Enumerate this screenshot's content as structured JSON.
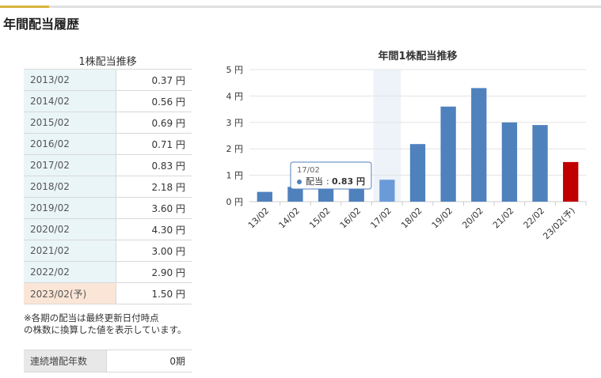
{
  "page": {
    "section_title": "年間配当履歴"
  },
  "table": {
    "title": "1株配当推移",
    "rows": [
      {
        "year": "2013/02",
        "value": "0.37 円"
      },
      {
        "year": "2014/02",
        "value": "0.56 円"
      },
      {
        "year": "2015/02",
        "value": "0.69 円"
      },
      {
        "year": "2016/02",
        "value": "0.71 円"
      },
      {
        "year": "2017/02",
        "value": "0.83 円"
      },
      {
        "year": "2018/02",
        "value": "2.18 円"
      },
      {
        "year": "2019/02",
        "value": "3.60 円"
      },
      {
        "year": "2020/02",
        "value": "4.30 円"
      },
      {
        "year": "2021/02",
        "value": "3.00 円"
      },
      {
        "year": "2022/02",
        "value": "2.90 円"
      },
      {
        "year": "2023/02(予)",
        "value": "1.50 円"
      }
    ]
  },
  "note": {
    "line1": "※各期の配当は最終更新日付時点",
    "line2": "の株数に換算した値を表示しています。"
  },
  "streak": {
    "label": "連続増配年数",
    "value": "0期"
  },
  "tooltip": {
    "category": "17/02",
    "series_label": "配当",
    "value": "0.83 円",
    "highlight_index": 4
  },
  "colors": {
    "bar": "#4f81bd",
    "bar_hover": "#6a9bd8",
    "forecast": "#c00000",
    "table_year_bg": "#eaf5f8",
    "forecast_bg": "#fbe5d6"
  },
  "chart_data": {
    "type": "bar",
    "title": "年間1株配当推移",
    "categories": [
      "13/02",
      "14/02",
      "15/02",
      "16/02",
      "17/02",
      "18/02",
      "19/02",
      "20/02",
      "21/02",
      "22/02",
      "23/02(予)"
    ],
    "values": [
      0.37,
      0.56,
      0.69,
      0.71,
      0.83,
      2.18,
      3.6,
      4.3,
      3.0,
      2.9,
      1.5
    ],
    "forecast_index": 10,
    "ylim": [
      0,
      5
    ],
    "yticks": [
      "0 円",
      "1 円",
      "2 円",
      "3 円",
      "4 円",
      "5 円"
    ],
    "grid": true,
    "legend": "none"
  }
}
